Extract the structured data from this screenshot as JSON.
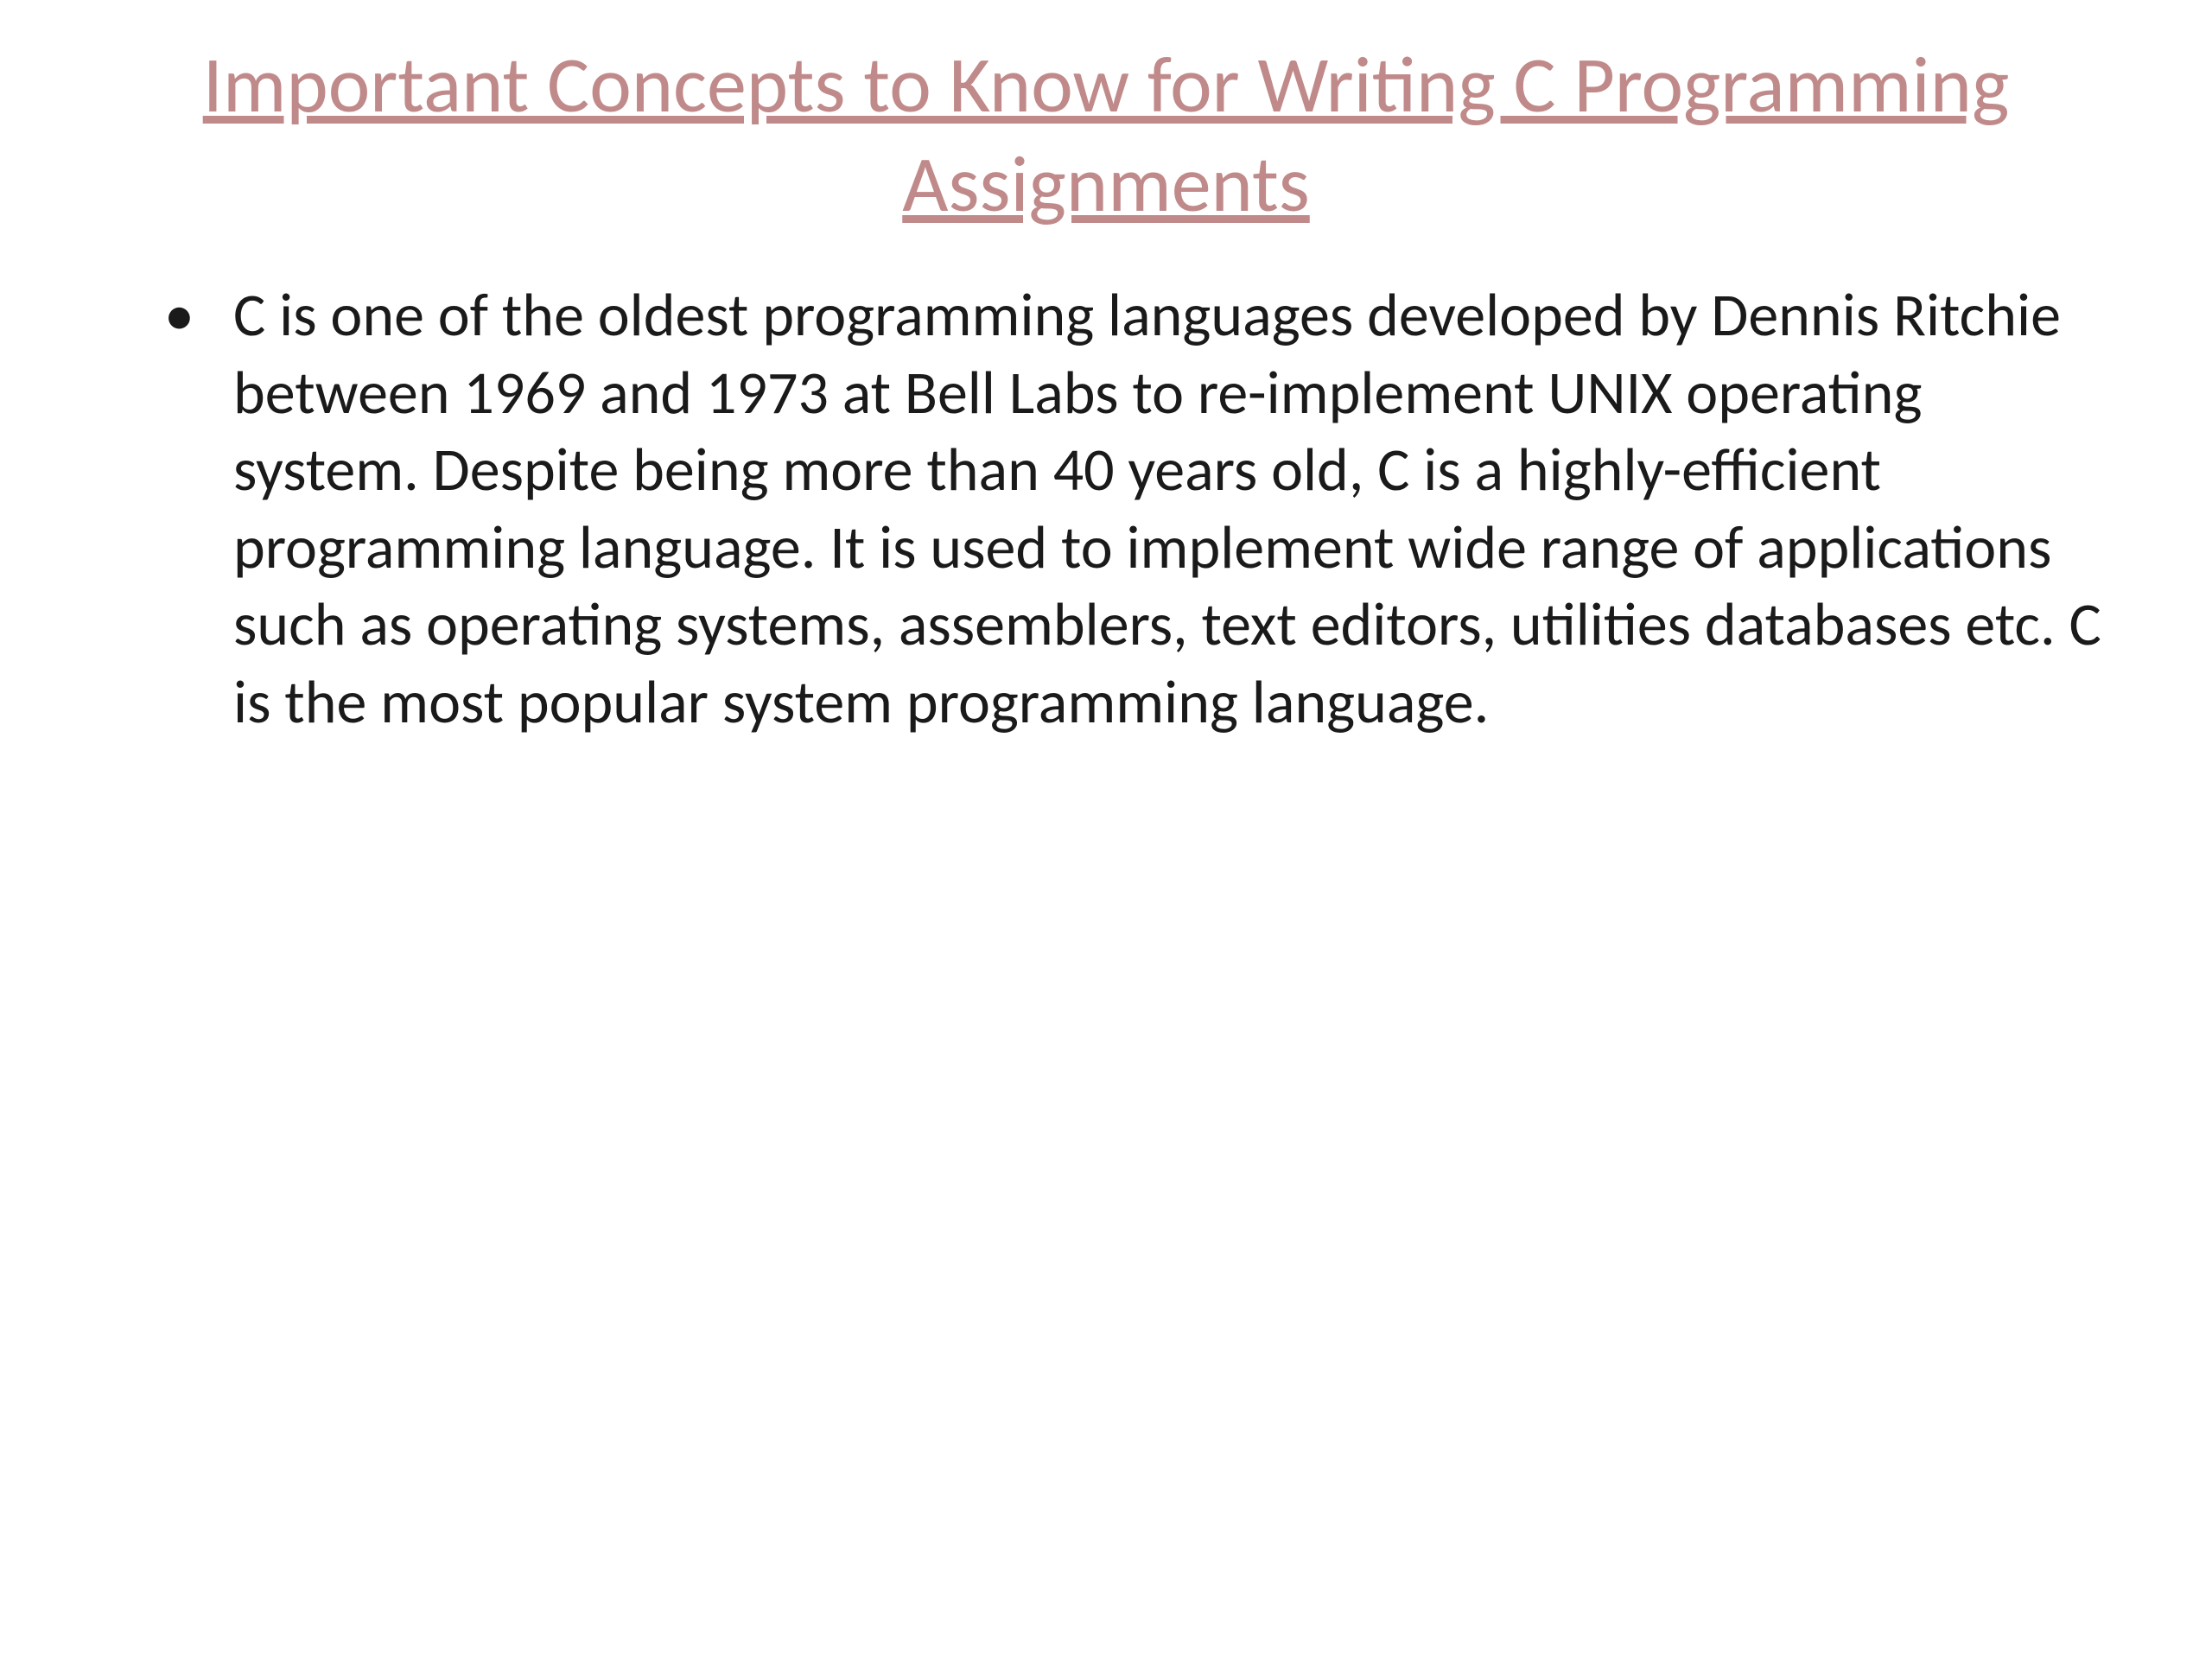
{
  "title": "Important Concepts to Know for Writing C Programming Assignments",
  "bullets": [
    "C is one of the oldest programming languages developed by Dennis Ritchie between 1969 and 1973 at Bell Labs to re-implement UNIX operating system. Despite being more than 40 years old, C is a highly-efficient programming language. It is used to implement wide range of applications such as operating systems, assemblers, text editors, utilities databases etc. C is the most popular system programming language."
  ]
}
